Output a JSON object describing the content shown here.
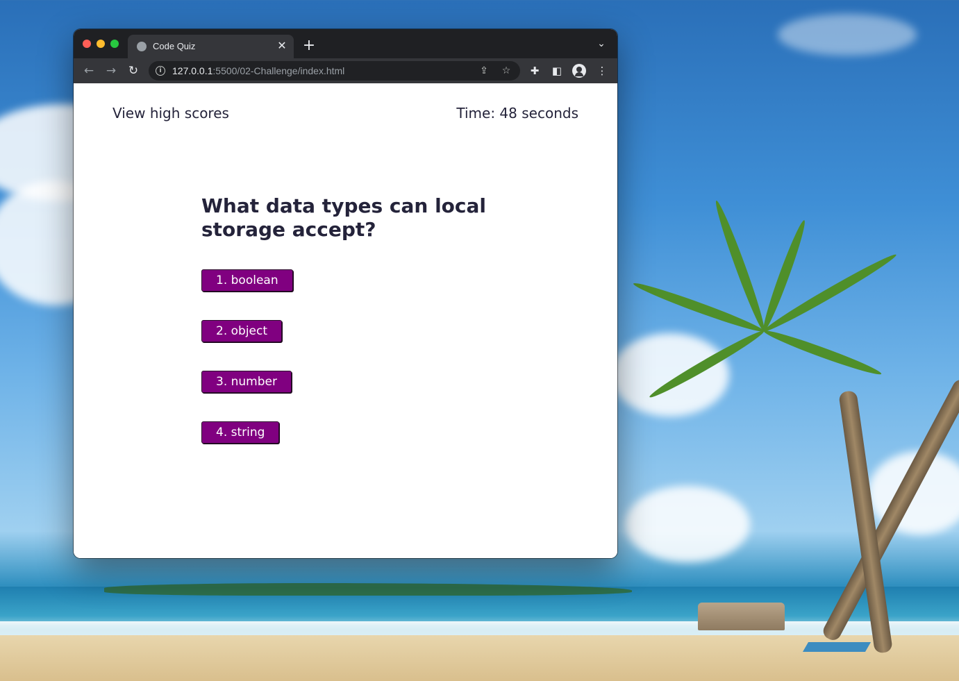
{
  "browser": {
    "tab_title": "Code Quiz",
    "url_host": "127.0.0.1",
    "url_rest": ":5500/02-Challenge/index.html"
  },
  "page": {
    "high_scores_link": "View high scores",
    "timer_text": "Time: 48 seconds",
    "question": "What data types can local storage accept?",
    "answers": [
      "1. boolean",
      "2. object",
      "3. number",
      "4. string"
    ],
    "button_color": "#800080"
  },
  "icons": {
    "close": "✕",
    "plus": "+",
    "chevron_down": "⌄",
    "back": "←",
    "forward": "→",
    "reload": "↻",
    "info": "i",
    "share": "⇪",
    "star": "☆",
    "puzzle": "✚",
    "panel": "◧",
    "kebab": "⋮"
  }
}
